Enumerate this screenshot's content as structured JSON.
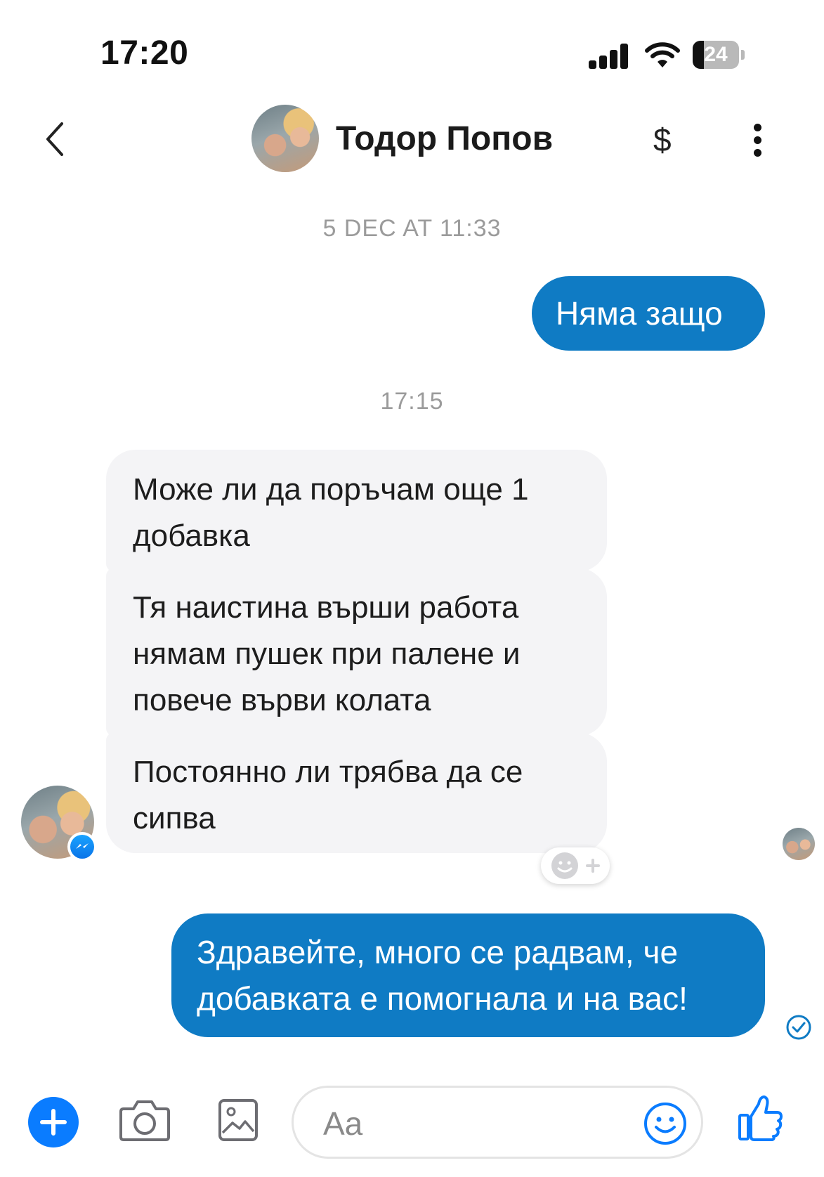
{
  "status_bar": {
    "time": "17:20",
    "battery_level": "24",
    "battery_fraction": 0.24
  },
  "header": {
    "back_icon": "chevron-left-icon",
    "contact_name": "Тодор Попов",
    "payment_icon": "$",
    "more_icon": "more-vertical-icon"
  },
  "messages": {
    "ts1": "5 DEC AT 11:33",
    "out1": "Няма защо",
    "ts2": "17:15",
    "in1": "Може ли да поръчам още 1 добавка",
    "in2": "Тя наистина върши работа нямам пушек при палене и повече върви колата",
    "in3": "Постоянно ли трябва да се сипва",
    "out2": "Здравейте, много се радвам, че добавката е помогнала и на вас!"
  },
  "composer": {
    "placeholder": "Aa"
  },
  "colors": {
    "accent": "#0f7bc4",
    "incoming_bubble": "#f4f4f6",
    "timestamp": "#9b9b9b",
    "plus_button": "#0a7cff"
  }
}
